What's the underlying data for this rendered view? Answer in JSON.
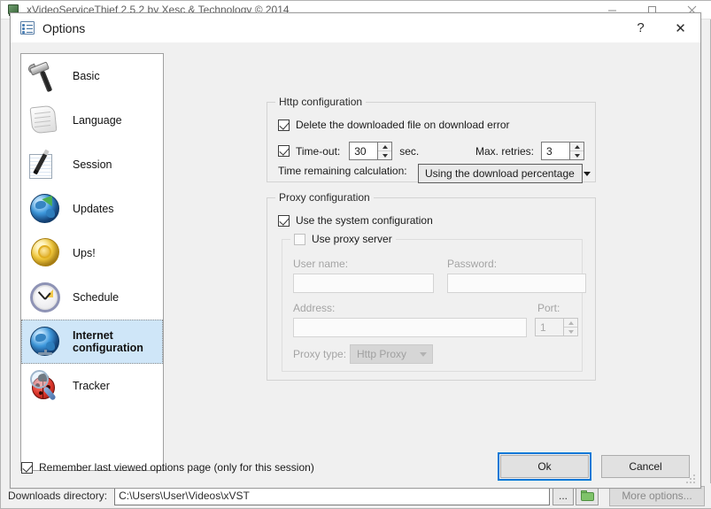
{
  "background_window": {
    "title": "xVideoServiceThief 2.5.2 by Xesc & Technology © 2014",
    "icon": "app-film-icon",
    "buttons": {
      "minimize": "—",
      "maximize": "□",
      "close": "✕"
    },
    "bottom_bar": {
      "downloads_label": "Downloads directory:",
      "downloads_path": "C:\\Users\\User\\Videos\\xVST",
      "browse_label": "...",
      "open_folder_icon": "folder-icon",
      "more_options_label": "More options..."
    }
  },
  "dialog": {
    "title": "Options",
    "icon": "options-list-icon",
    "help_label": "?",
    "close_label": "✕"
  },
  "sidebar": {
    "items": [
      {
        "label": "Basic",
        "icon": "hammer-icon",
        "selected": false
      },
      {
        "label": "Language",
        "icon": "scroll-icon",
        "selected": false
      },
      {
        "label": "Session",
        "icon": "notepad-pen-icon",
        "selected": false
      },
      {
        "label": "Updates",
        "icon": "globe-update-icon",
        "selected": false
      },
      {
        "label": "Ups!",
        "icon": "gold-coin-icon",
        "selected": false
      },
      {
        "label": "Schedule",
        "icon": "clock-icon",
        "selected": false
      },
      {
        "label": "Internet configuration",
        "icon": "globe-icon",
        "selected": true
      },
      {
        "label": "Tracker",
        "icon": "ladybug-magnifier-icon",
        "selected": false
      }
    ]
  },
  "http_group": {
    "title": "Http configuration",
    "delete_on_error_label": "Delete the downloaded file on download error",
    "delete_on_error_checked": true,
    "timeout_label": "Time-out:",
    "timeout_checked": true,
    "timeout_value": "30",
    "timeout_unit": "sec.",
    "max_retries_label": "Max. retries:",
    "max_retries_value": "3",
    "time_remaining_label": "Time remaining calculation:",
    "time_remaining_value": "Using the download percentage"
  },
  "proxy_group": {
    "title": "Proxy configuration",
    "use_system_label": "Use the system configuration",
    "use_system_checked": true,
    "use_proxy_server_label": "Use proxy server",
    "use_proxy_server_checked": false,
    "username_label": "User name:",
    "username_value": "",
    "password_label": "Password:",
    "password_value": "",
    "address_label": "Address:",
    "address_value": "",
    "port_label": "Port:",
    "port_value": "1",
    "proxy_type_label": "Proxy type:",
    "proxy_type_value": "Http Proxy"
  },
  "footer": {
    "remember_label": "Remember last viewed options page (only for this session)",
    "remember_checked": true,
    "ok_label": "Ok",
    "cancel_label": "Cancel"
  },
  "colors": {
    "dialog_bg": "#f0f0f0",
    "selection_blue": "#cfe6f8",
    "focus_blue": "#0078d7",
    "disabled_text": "#a4a4a4"
  }
}
